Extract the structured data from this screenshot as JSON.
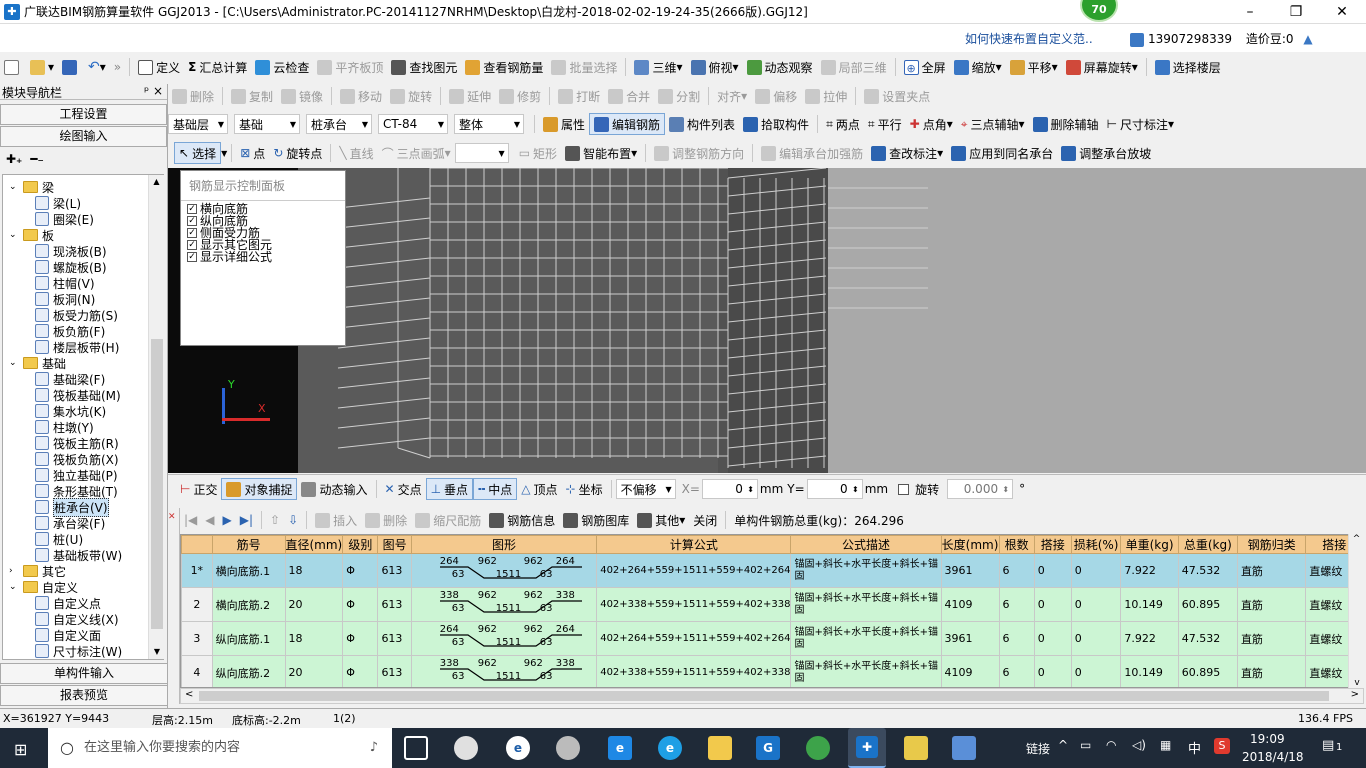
{
  "window": {
    "title": "广联达BIM钢筋算量软件 GGJ2013 - [C:\\Users\\Administrator.PC-20141127NRHM\\Desktop\\白龙村-2018-02-02-19-24-35(2666版).GGJ12]",
    "badge": "70",
    "help_link": "如何快速布置自定义范..",
    "user": "13907298339",
    "price_beans": "造价豆:0"
  },
  "toolbar1": {
    "items": [
      "定义",
      "汇总计算",
      "云检查",
      "平齐板顶",
      "查找图元",
      "查看钢筋量",
      "批量选择",
      "三维",
      "俯视",
      "动态观察",
      "局部三维",
      "全屏",
      "缩放",
      "平移",
      "屏幕旋转",
      "选择楼层"
    ]
  },
  "toolbar2": {
    "items": [
      "删除",
      "复制",
      "镜像",
      "移动",
      "旋转",
      "延伸",
      "修剪",
      "打断",
      "合并",
      "分割",
      "对齐",
      "偏移",
      "拉伸",
      "设置夹点"
    ]
  },
  "toolbar3": {
    "floor": "基础层",
    "category": "基础",
    "type": "桩承台",
    "component": "CT-84",
    "whole": "整体",
    "items": [
      "属性",
      "编辑钢筋",
      "构件列表",
      "拾取构件",
      "两点",
      "平行",
      "点角",
      "三点辅轴",
      "删除辅轴",
      "尺寸标注"
    ]
  },
  "toolbar4": {
    "items": [
      "选择",
      "点",
      "旋转点",
      "直线",
      "三点画弧",
      "矩形",
      "智能布置",
      "调整钢筋方向",
      "编辑承台加强筋",
      "查改标注",
      "应用到同名承台",
      "调整承台放坡"
    ]
  },
  "left_panel": {
    "title": "模块导航栏",
    "pin": "ᵖ ×",
    "project_settings": "工程设置",
    "drawing_input": "绘图输入",
    "single_input": "单构件输入",
    "report_preview": "报表预览",
    "tree": [
      {
        "label": "梁",
        "level": 0,
        "folder": true
      },
      {
        "label": "梁(L)",
        "level": 1
      },
      {
        "label": "圈梁(E)",
        "level": 1
      },
      {
        "label": "板",
        "level": 0,
        "folder": true
      },
      {
        "label": "现浇板(B)",
        "level": 1
      },
      {
        "label": "螺旋板(B)",
        "level": 1
      },
      {
        "label": "柱帽(V)",
        "level": 1
      },
      {
        "label": "板洞(N)",
        "level": 1
      },
      {
        "label": "板受力筋(S)",
        "level": 1
      },
      {
        "label": "板负筋(F)",
        "level": 1
      },
      {
        "label": "楼层板带(H)",
        "level": 1
      },
      {
        "label": "基础",
        "level": 0,
        "folder": true
      },
      {
        "label": "基础梁(F)",
        "level": 1
      },
      {
        "label": "筏板基础(M)",
        "level": 1
      },
      {
        "label": "集水坑(K)",
        "level": 1
      },
      {
        "label": "柱墩(Y)",
        "level": 1
      },
      {
        "label": "筏板主筋(R)",
        "level": 1
      },
      {
        "label": "筏板负筋(X)",
        "level": 1
      },
      {
        "label": "独立基础(P)",
        "level": 1
      },
      {
        "label": "条形基础(T)",
        "level": 1
      },
      {
        "label": "桩承台(V)",
        "level": 1,
        "selected": true
      },
      {
        "label": "承台梁(F)",
        "level": 1
      },
      {
        "label": "桩(U)",
        "level": 1
      },
      {
        "label": "基础板带(W)",
        "level": 1
      },
      {
        "label": "其它",
        "level": 0,
        "folder": true,
        "collapsed": true
      },
      {
        "label": "自定义",
        "level": 0,
        "folder": true
      },
      {
        "label": "自定义点",
        "level": 1
      },
      {
        "label": "自定义线(X)",
        "level": 1
      },
      {
        "label": "自定义面",
        "level": 1
      },
      {
        "label": "尺寸标注(W)",
        "level": 1
      }
    ]
  },
  "control_panel": {
    "title": "钢筋显示控制面板",
    "options": [
      "横向底筋",
      "纵向底筋",
      "侧面受力筋",
      "显示其它图元",
      "显示详细公式"
    ]
  },
  "snapbar": {
    "items": [
      "正交",
      "对象捕捉",
      "动态输入",
      "交点",
      "垂点",
      "中点",
      "顶点",
      "坐标"
    ],
    "offset_mode": "不偏移",
    "x_label": "X=",
    "x_value": "0",
    "y_label": "Y=",
    "y_value": "0",
    "unit": "mm",
    "rotate_label": "旋转",
    "rotate_value": "0.000",
    "degree": "°"
  },
  "rebar_toolbar": {
    "items": [
      "插入",
      "删除",
      "缩尺配筋",
      "钢筋信息",
      "钢筋图库",
      "其他",
      "关闭"
    ],
    "total_weight": "单构件钢筋总重(kg)：264.296"
  },
  "table": {
    "headers": [
      "筋号",
      "直径(mm)",
      "级别",
      "图号",
      "图形",
      "计算公式",
      "公式描述",
      "长度(mm)",
      "根数",
      "搭接",
      "损耗(%)",
      "单重(kg)",
      "总重(kg)",
      "钢筋归类",
      "搭接"
    ],
    "rows": [
      {
        "rn": "1*",
        "name": "横向底筋.1",
        "dia": "18",
        "grade": "Φ",
        "fig": "613",
        "shape": {
          "l": "264",
          "m1": "962",
          "m2": "962",
          "r": "264",
          "b1": "63",
          "bm": "1511",
          "b2": "63"
        },
        "formula": "402+264+559+1511+559+402+264",
        "desc": "锚固+斜长+水平长度+斜长+锚固",
        "length": "3961",
        "count": "6",
        "lap": "0",
        "loss": "0",
        "unit_w": "7.922",
        "total_w": "47.532",
        "cat": "直筋",
        "lap2": "直螺纹"
      },
      {
        "rn": "2",
        "name": "横向底筋.2",
        "dia": "20",
        "grade": "Φ",
        "fig": "613",
        "shape": {
          "l": "338",
          "m1": "962",
          "m2": "962",
          "r": "338",
          "b1": "63",
          "bm": "1511",
          "b2": "63"
        },
        "formula": "402+338+559+1511+559+402+338",
        "desc": "锚固+斜长+水平长度+斜长+锚固",
        "length": "4109",
        "count": "6",
        "lap": "0",
        "loss": "0",
        "unit_w": "10.149",
        "total_w": "60.895",
        "cat": "直筋",
        "lap2": "直螺纹"
      },
      {
        "rn": "3",
        "name": "纵向底筋.1",
        "dia": "18",
        "grade": "Φ",
        "fig": "613",
        "shape": {
          "l": "264",
          "m1": "962",
          "m2": "962",
          "r": "264",
          "b1": "63",
          "bm": "1511",
          "b2": "63"
        },
        "formula": "402+264+559+1511+559+402+264",
        "desc": "锚固+斜长+水平长度+斜长+锚固",
        "length": "3961",
        "count": "6",
        "lap": "0",
        "loss": "0",
        "unit_w": "7.922",
        "total_w": "47.532",
        "cat": "直筋",
        "lap2": "直螺纹"
      },
      {
        "rn": "4",
        "name": "纵向底筋.2",
        "dia": "20",
        "grade": "Φ",
        "fig": "613",
        "shape": {
          "l": "338",
          "m1": "962",
          "m2": "962",
          "r": "338",
          "b1": "63",
          "bm": "1511",
          "b2": "63"
        },
        "formula": "402+338+559+1511+559+402+338",
        "desc": "锚固+斜长+水平长度+斜长+锚固",
        "length": "4109",
        "count": "6",
        "lap": "0",
        "loss": "0",
        "unit_w": "10.149",
        "total_w": "60.895",
        "cat": "直筋",
        "lap2": "直螺纹"
      }
    ]
  },
  "status": {
    "coords": "X=361927 Y=9443",
    "floor_height": "层高:2.15m",
    "bottom_elev": "底标高:-2.2m",
    "count": "1(2)",
    "fps": "136.4 FPS"
  },
  "taskbar": {
    "search_placeholder": "在这里输入你要搜索的内容",
    "network": "链接",
    "ime": "中",
    "time": "19:09",
    "date": "2018/4/18",
    "notifications": "1"
  }
}
